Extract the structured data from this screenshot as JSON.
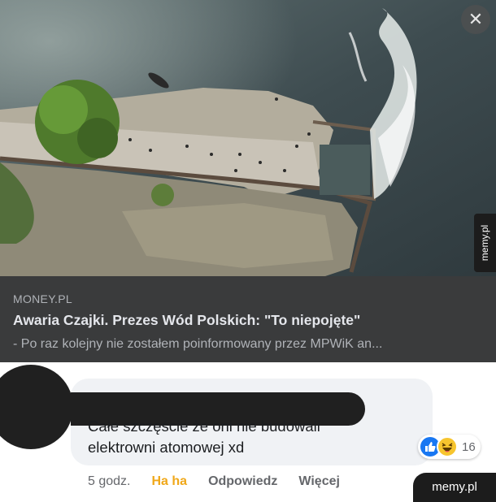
{
  "preview": {
    "close_icon": "close-icon",
    "source": "MONEY.PL",
    "title": "Awaria Czajki. Prezes Wód Polskich: \"To niepojęte\"",
    "description": "- Po raz kolejny nie zostałem poinformowany przez MPWiK an..."
  },
  "comment": {
    "text_line1": "Całe szczęście że oni nie budowali",
    "text_line2": "elektrowni atomowej xd",
    "reactions": {
      "icons": [
        "like-icon",
        "haha-icon"
      ],
      "count": "16"
    },
    "actions": {
      "time": "5 godz.",
      "haha": "Ha ha",
      "reply": "Odpowiedz",
      "more": "Więcej"
    }
  },
  "watermarks": {
    "side": "memy.pl",
    "corner": "memy.pl"
  },
  "colors": {
    "card_bg": "#3a3b3c",
    "bubble_bg": "#f0f2f5",
    "haha_accent": "#f0a81a",
    "like_blue": "#1877f2"
  }
}
